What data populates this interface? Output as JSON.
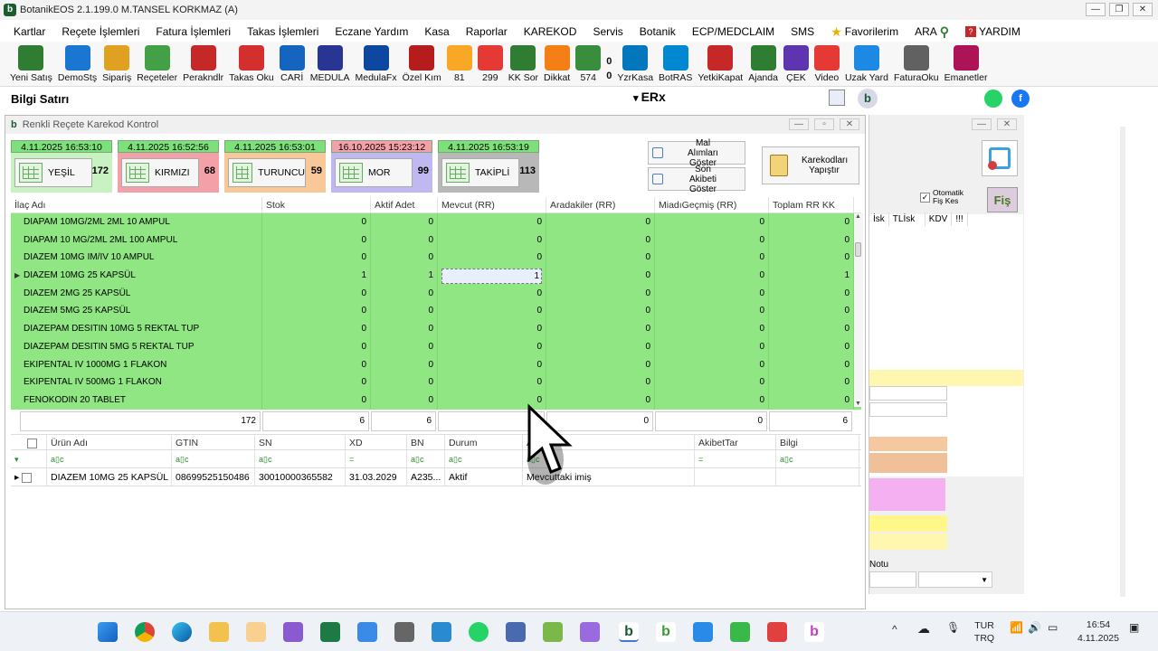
{
  "app": {
    "title": "BotanikEOS 2.1.199.0 M.TANSEL KORKMAZ (A)"
  },
  "menu": [
    "Kartlar",
    "Reçete İşlemleri",
    "Fatura İşlemleri",
    "Takas İşlemleri",
    "Eczane Yardım",
    "Kasa",
    "Raporlar",
    "KAREKOD",
    "Servis",
    "Botanik",
    "ECP/MEDCLAIM",
    "SMS",
    "Favorilerim",
    "ARA",
    "YARDIM"
  ],
  "toolbar": [
    {
      "label": "Yeni Satış",
      "icon": "botanik-b-icon",
      "color": "#2e7d32"
    },
    {
      "label": "DemoStş",
      "icon": "demo-b-icon",
      "color": "#1976d2"
    },
    {
      "label": "Sipariş",
      "icon": "basket-icon",
      "color": "#e0a020"
    },
    {
      "label": "Reçeteler",
      "icon": "rx-icon",
      "color": "#43a047"
    },
    {
      "label": "Perakndlr",
      "icon": "cash-register-icon",
      "color": "#c62828"
    },
    {
      "label": "Takas Oku",
      "icon": "exchange-icon",
      "color": "#d32f2f"
    },
    {
      "label": "CARİ",
      "icon": "calculator-icon",
      "color": "#1565c0"
    },
    {
      "label": "MEDULA",
      "icon": "sgk-icon",
      "color": "#283593"
    },
    {
      "label": "MedulaFx",
      "icon": "fx-icon",
      "color": "#0d47a1"
    },
    {
      "label": "Özel Kım",
      "icon": "card-icon",
      "color": "#b71c1c"
    },
    {
      "label": "81",
      "icon": "badge-81-icon",
      "color": "#f9a825"
    },
    {
      "label": "299",
      "icon": "hourglass-icon",
      "color": "#e53935"
    },
    {
      "label": "KK Sor",
      "icon": "check-icon",
      "color": "#2e7d32"
    },
    {
      "label": "Dikkat",
      "icon": "warning-icon",
      "color": "#f57f17"
    },
    {
      "label": "574",
      "icon": "tag-icon",
      "color": "#388e3c"
    },
    {
      "label": "0",
      "icon": "bottle-icon",
      "color": "#558b2f"
    },
    {
      "label": "YzrKasa",
      "icon": "printer-icon",
      "color": "#0277bd"
    },
    {
      "label": "BotRAS",
      "icon": "chat-icon",
      "color": "#0288d1"
    },
    {
      "label": "YetkiKapat",
      "icon": "lock-icon",
      "color": "#c62828"
    },
    {
      "label": "Ajanda",
      "icon": "agenda-icon",
      "color": "#2e7d32"
    },
    {
      "label": "ÇEK",
      "icon": "check-doc-icon",
      "color": "#5e35b1"
    },
    {
      "label": "Video",
      "icon": "video-icon",
      "color": "#e53935"
    },
    {
      "label": "Uzak Yard",
      "icon": "remote-icon",
      "color": "#1e88e5"
    },
    {
      "label": "FaturaOku",
      "icon": "invoice-icon",
      "color": "#616161"
    },
    {
      "label": "Emanetler",
      "icon": "network-icon",
      "color": "#ad1457"
    }
  ],
  "counters": {
    "top": "0",
    "bottom": "0"
  },
  "bilgi": {
    "label": "Bilgi Satırı",
    "erx": "ERx"
  },
  "window": {
    "title": "Renkli Reçete Karekod Kontrol"
  },
  "status_boxes": [
    {
      "date": "4.11.2025 16:53:10",
      "label": "YEŞİL",
      "count": "172",
      "date_bg": "#7ee07a",
      "bg": "#c8f2c2"
    },
    {
      "date": "4.11.2025 16:52:56",
      "label": "KIRMIZI",
      "count": "68",
      "date_bg": "#7ee07a",
      "bg": "#f4a0a8"
    },
    {
      "date": "4.11.2025 16:53:01",
      "label": "TURUNCU",
      "count": "59",
      "date_bg": "#7ee07a",
      "bg": "#f8c898"
    },
    {
      "date": "16.10.2025 15:23:12",
      "label": "MOR",
      "count": "99",
      "date_bg": "#f4a0a8",
      "bg": "#c0b8f0"
    },
    {
      "date": "4.11.2025 16:53:19",
      "label": "TAKİPLİ",
      "count": "113",
      "date_bg": "#7ee07a",
      "bg": "#b8b8b8"
    }
  ],
  "buttons": {
    "mal_alimlari": "Mal Alımları Göster",
    "son_akibeti": "Son Akibeti Göster",
    "karekodlari": "Karekodları Yapıştır"
  },
  "grid": {
    "headers": [
      "İlaç Adı",
      "Stok",
      "Aktif Adet",
      "Mevcut (RR)",
      "Aradakiler (RR)",
      "MiadıGeçmiş (RR)",
      "Toplam RR KK"
    ],
    "rows": [
      [
        "DIAPAM 10MG/2ML 2ML 10 AMPUL",
        "0",
        "0",
        "0",
        "0",
        "0",
        "0"
      ],
      [
        "DIAPAM 10 MG/2ML 2ML 100 AMPUL",
        "0",
        "0",
        "0",
        "0",
        "0",
        "0"
      ],
      [
        "DIAZEM 10MG IM/IV 10 AMPUL",
        "0",
        "0",
        "0",
        "0",
        "0",
        "0"
      ],
      [
        "DIAZEM 10MG 25 KAPSÜL",
        "1",
        "1",
        "1",
        "0",
        "0",
        "1"
      ],
      [
        "DIAZEM 2MG 25 KAPSÜL",
        "0",
        "0",
        "0",
        "0",
        "0",
        "0"
      ],
      [
        "DIAZEM 5MG 25 KAPSÜL",
        "0",
        "0",
        "0",
        "0",
        "0",
        "0"
      ],
      [
        "DIAZEPAM DESITIN 10MG 5 REKTAL TUP",
        "0",
        "0",
        "0",
        "0",
        "0",
        "0"
      ],
      [
        "DIAZEPAM DESITIN 5MG 5 REKTAL TUP",
        "0",
        "0",
        "0",
        "0",
        "0",
        "0"
      ],
      [
        "EKIPENTAL IV 1000MG 1 FLAKON",
        "0",
        "0",
        "0",
        "0",
        "0",
        "0"
      ],
      [
        "EKIPENTAL IV 500MG 1 FLAKON",
        "0",
        "0",
        "0",
        "0",
        "0",
        "0"
      ],
      [
        "FENOKODIN 20 TABLET",
        "0",
        "0",
        "0",
        "0",
        "0",
        "0"
      ]
    ],
    "totals": [
      "172",
      "6",
      "6",
      "6",
      "0",
      "0",
      "6"
    ]
  },
  "detail": {
    "headers": [
      "Ürün Adı",
      "GTIN",
      "SN",
      "XD",
      "BN",
      "Durum",
      "Açıklama",
      "AkibetTar",
      "Bilgi"
    ],
    "filters": [
      "a▯c",
      "a▯c",
      "a▯c",
      "=",
      "a▯c",
      "a▯c",
      "a▯c",
      "=",
      "a▯c"
    ],
    "rows": [
      [
        "DIAZEM 10MG 25 KAPSÜL",
        "08699525150486",
        "30010000365582",
        "31.03.2029",
        "A235...",
        "Aktif",
        "Mevcuttaki imiş",
        "",
        ""
      ]
    ]
  },
  "right_panel": {
    "otomatik": "Otomatik Fiş Kes",
    "cols": [
      "İsk",
      "TLİsk",
      "KDV",
      "!!!"
    ],
    "notu": "Notu"
  },
  "taskbar": {
    "lang1": "TUR",
    "lang2": "TRQ",
    "time": "16:54",
    "date": "4.11.2025"
  }
}
